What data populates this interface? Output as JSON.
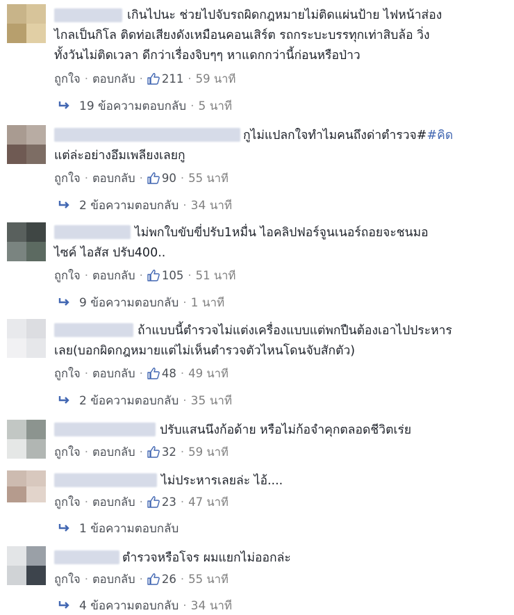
{
  "labels": {
    "like": "ถูกใจ",
    "reply": "ตอบกลับ",
    "sep": "·"
  },
  "accent": "#4267b2",
  "comments": [
    {
      "text": "เกินไปนะ ช่วยไปจับรถผิดกฎหมายไม่ติดแผ่นป้าย ไฟหน้าส่อง\nไกลเป็นกิโล ติดท่อเสียงดังเหมือนคอนเสิร์ต รถกระบะบรรทุกเท่าสิบล้อ วิ่ง\nทั้งวันไม่ติดเวลา ดีกว่าเรื่องจิบๆๆ หาแดกกว่านี้ก่อนหรือป่าว",
      "likes": "211",
      "time": "59 นาที",
      "replies_label": "19 ข้อความตอบกลับ",
      "replies_time": "5 นาที"
    },
    {
      "text_before_tag": "กูไม่แปลกใจทำไมคนถึงด่าตำรวจ#",
      "tag": "#คิด",
      "text_after_tag": "\nแต่ล่ะอย่างอึมเพลียงเลยกู",
      "likes": "90",
      "time": "55 นาที",
      "replies_label": "2 ข้อความตอบกลับ",
      "replies_time": "34 นาที"
    },
    {
      "text": "ไม่พกใบขับขี่ปรับ1หมื่น ไอคลิปฟอร์จูนเนอร์ถอยจะชนมอ\nไซค์ ไอสัส ปรับ400..",
      "likes": "105",
      "time": "51 นาที",
      "replies_label": "9 ข้อความตอบกลับ",
      "replies_time": "1 นาที"
    },
    {
      "text": "ถ้าแบบนี้ตำรวจไม่แต่งเครื่องแบบแต่พกปืนต้องเอาไปประหาร\nเลย(บอกผิดกฎหมายแต่ไม่เห็นตำรวจตัวไหนโดนจับสักตัว)",
      "likes": "48",
      "time": "49 นาที",
      "replies_label": "2 ข้อความตอบกลับ",
      "replies_time": "35 นาที"
    },
    {
      "text": "ปรับแสนนึงก้อด้าย หรือไม่ก้อจำคุกตลอดชีวิตเร่ย",
      "likes": "32",
      "time": "59 นาที"
    },
    {
      "text": "ไม่ประหารเลยล่ะ ไอ้....",
      "likes": "23",
      "time": "47 นาที",
      "replies_label": "1 ข้อความตอบกลับ"
    },
    {
      "text": "ตำรวจหรือโจร ผมแยกไม่ออกล่ะ",
      "likes": "26",
      "time": "55 นาที",
      "replies_label": "4 ข้อความตอบกลับ",
      "replies_time": "34 นาที"
    }
  ]
}
